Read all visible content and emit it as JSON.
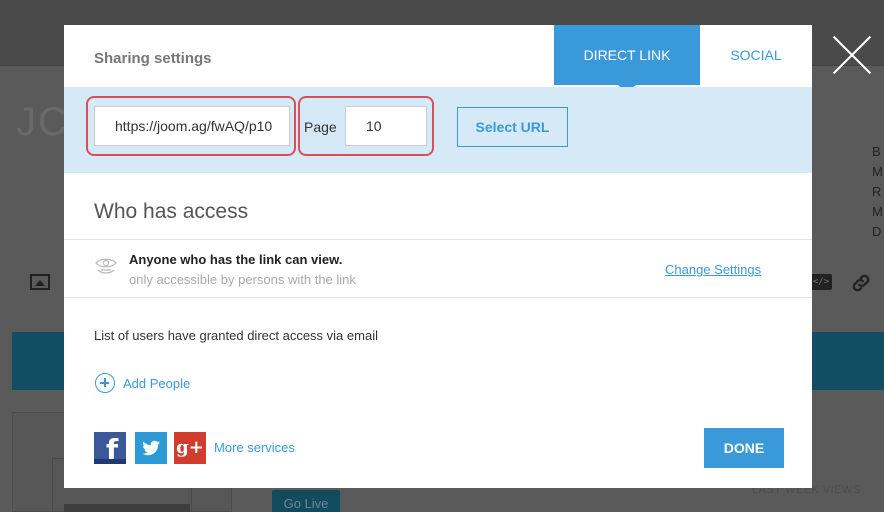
{
  "background": {
    "title_fragment": "JC",
    "right_letters": [
      "B",
      "M",
      "R",
      "M",
      "D"
    ],
    "embed_icon_glyph": "</>",
    "go_live_label": "Go Live",
    "last_week_label": "LAST WEEK VIEWS"
  },
  "modal": {
    "title": "Sharing settings",
    "tabs": [
      {
        "label": "DIRECT LINK",
        "active": true
      },
      {
        "label": "SOCIAL",
        "active": false
      }
    ],
    "url_band": {
      "url_value": "https://joom.ag/fwAQ/p10",
      "page_label": "Page",
      "page_value": "10",
      "select_url_label": "Select URL"
    },
    "access": {
      "heading": "Who has access",
      "primary_text": "Anyone who has the link can view.",
      "secondary_text": "only accessible by persons with the link",
      "change_settings_label": "Change Settings"
    },
    "users": {
      "list_text": "List of users have granted direct access via email",
      "add_people_label": "Add People"
    },
    "footer": {
      "facebook_glyph": "f",
      "google_glyph": "g+",
      "more_services_label": "More services",
      "done_label": "DONE"
    }
  },
  "colors": {
    "accent": "#3a9ad9",
    "url_band": "#d6e9f7",
    "highlight": "#d8505a",
    "facebook": "#3b5998",
    "twitter": "#2b9ad6",
    "google": "#d23c2f"
  }
}
